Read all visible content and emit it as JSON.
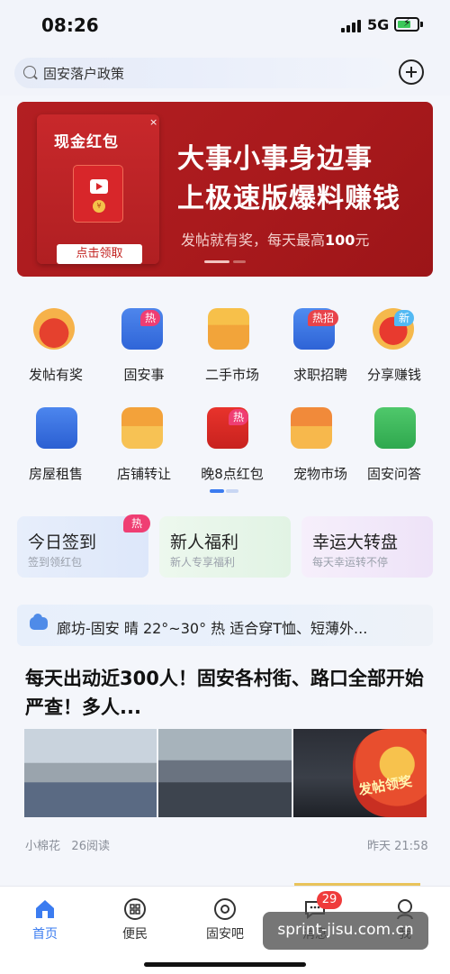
{
  "status_bar": {
    "time": "08:26",
    "network": "5G"
  },
  "search": {
    "placeholder": "固安落户政策"
  },
  "banner": {
    "card_title": "现金红包",
    "card_close": "×",
    "card_button": "点击领取",
    "headline_1": "大事小事身边事",
    "headline_2": "上极速版爆料赚钱",
    "subline_prefix": "发帖就有奖，每天最高",
    "subline_amount": "100",
    "subline_suffix": "元",
    "accent_color": "#b31f22"
  },
  "grid": [
    {
      "label": "发帖有奖",
      "icon": "red-lucky-bag-icon",
      "badge": ""
    },
    {
      "label": "固安事",
      "icon": "news-document-icon",
      "badge": "热"
    },
    {
      "label": "二手市场",
      "icon": "gift-box-icon",
      "badge": ""
    },
    {
      "label": "求职招聘",
      "icon": "briefcase-icon",
      "badge": "热招"
    },
    {
      "label": "分享赚钱",
      "icon": "red-envelope-share-icon",
      "badge": "新"
    },
    {
      "label": "房屋租售",
      "icon": "building-icon",
      "badge": ""
    },
    {
      "label": "店铺转让",
      "icon": "storefront-icon",
      "badge": ""
    },
    {
      "label": "晚8点红包",
      "icon": "red-packet-icon",
      "badge": "热"
    },
    {
      "label": "宠物市场",
      "icon": "pet-cat-box-icon",
      "badge": ""
    },
    {
      "label": "固安问答",
      "icon": "chat-bubble-icon",
      "badge": ""
    }
  ],
  "promos": [
    {
      "title": "今日签到",
      "subtitle": "签到领红包",
      "badge": "热"
    },
    {
      "title": "新人福利",
      "subtitle": "新人专享福利",
      "badge": ""
    },
    {
      "title": "幸运大转盘",
      "subtitle": "每天幸运转不停",
      "badge": ""
    }
  ],
  "weather": {
    "text": "廊坊-固安 晴 22°~30° 热 适合穿T恤、短薄外..."
  },
  "article": {
    "title": "每天出动近300人！固安各村街、路口全部开始严查！多人...",
    "author": "小棉花",
    "reads": "26阅读",
    "time": "昨天 21:58",
    "overlay_label": "发帖领奖"
  },
  "tabbar": [
    {
      "label": "首页",
      "icon": "home-icon",
      "active": true
    },
    {
      "label": "便民",
      "icon": "grid-apps-icon",
      "active": false
    },
    {
      "label": "固安吧",
      "icon": "location-pin-icon",
      "active": false
    },
    {
      "label": "消息",
      "icon": "message-icon",
      "active": false,
      "badge": "29"
    },
    {
      "label": "我",
      "icon": "profile-icon",
      "active": false
    }
  ],
  "watermark": "sprint-jisu.com.cn"
}
